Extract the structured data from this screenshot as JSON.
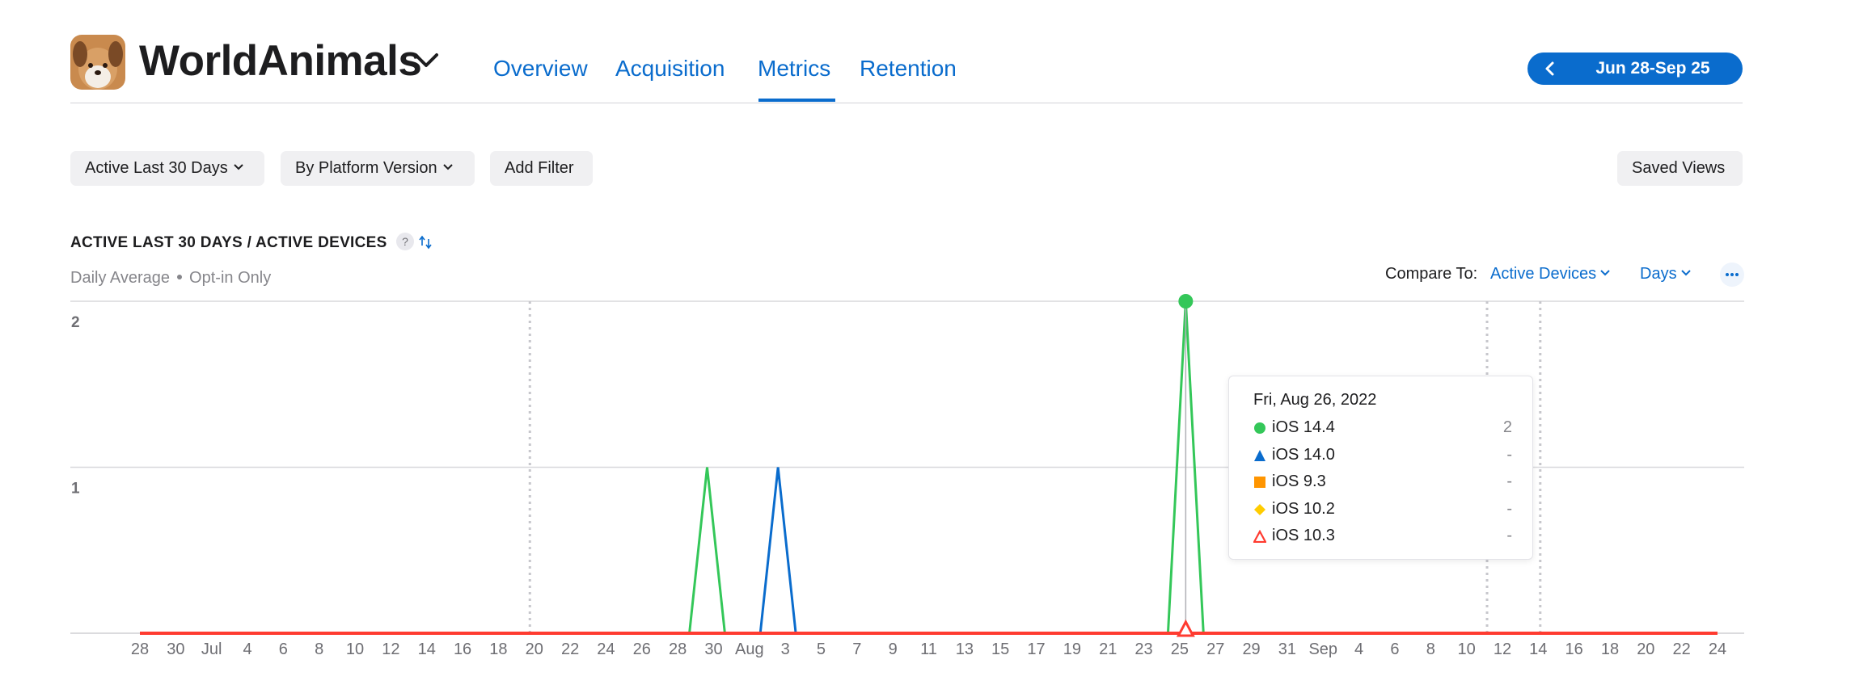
{
  "app": {
    "name": "WorldAnimals"
  },
  "tabs": [
    {
      "label": "Overview"
    },
    {
      "label": "Acquisition"
    },
    {
      "label": "Metrics",
      "active": true
    },
    {
      "label": "Retention"
    }
  ],
  "date_range": {
    "label": "Jun 28-Sep 25"
  },
  "filters": {
    "measure": "Active Last 30 Days",
    "breakdown": "By Platform Version",
    "add_filter": "Add Filter",
    "saved_views": "Saved Views"
  },
  "section": {
    "title": "ACTIVE LAST 30 DAYS / ACTIVE DEVICES",
    "help": "?",
    "subtitle_a": "Daily Average",
    "subtitle_b": "Opt-in Only"
  },
  "compare": {
    "label": "Compare To:",
    "metric": "Active Devices",
    "granularity": "Days"
  },
  "colors": {
    "accent": "#0a6ccd",
    "ios_14_4": "#34c759",
    "ios_14_0": "#0a6ccd",
    "ios_9_3": "#ff9500",
    "ios_10_2": "#ffcc00",
    "ios_10_3": "#ff3b30"
  },
  "tooltip": {
    "date": "Fri, Aug 26, 2022",
    "rows": [
      {
        "name": "iOS 14.4",
        "value": "2",
        "marker": "circle",
        "color": "#34c759"
      },
      {
        "name": "iOS 14.0",
        "value": "-",
        "marker": "triangle",
        "color": "#0a6ccd"
      },
      {
        "name": "iOS 9.3",
        "value": "-",
        "marker": "square",
        "color": "#ff9500"
      },
      {
        "name": "iOS 10.2",
        "value": "-",
        "marker": "diamond",
        "color": "#ffcc00"
      },
      {
        "name": "iOS 10.3",
        "value": "-",
        "marker": "triangle-outline",
        "color": "#ff3b30"
      }
    ]
  },
  "chart_data": {
    "type": "line",
    "x_start": "2022-06-28",
    "x_end": "2022-09-25",
    "x_ticks": [
      "28",
      "30",
      "Jul",
      "4",
      "6",
      "8",
      "10",
      "12",
      "14",
      "16",
      "18",
      "20",
      "22",
      "24",
      "26",
      "28",
      "30",
      "Aug",
      "3",
      "5",
      "7",
      "9",
      "11",
      "13",
      "15",
      "17",
      "19",
      "21",
      "23",
      "25",
      "27",
      "29",
      "31",
      "Sep",
      "4",
      "6",
      "8",
      "10",
      "12",
      "14",
      "16",
      "18",
      "20",
      "22",
      "24"
    ],
    "y_ticks": [
      "1",
      "2"
    ],
    "ylim": [
      0,
      2
    ],
    "selected_date": "2022-08-26",
    "series": [
      {
        "name": "iOS 14.4",
        "color": "#34c759",
        "points": [
          [
            "2022-07-30",
            1
          ],
          [
            "2022-08-26",
            2
          ]
        ]
      },
      {
        "name": "iOS 14.0",
        "color": "#0a6ccd",
        "points": [
          [
            "2022-08-03",
            1
          ]
        ]
      },
      {
        "name": "iOS 9.3",
        "color": "#ff9500",
        "points": []
      },
      {
        "name": "iOS 10.2",
        "color": "#ffcc00",
        "points": []
      },
      {
        "name": "iOS 10.3",
        "color": "#ff3b30",
        "points": []
      }
    ]
  }
}
